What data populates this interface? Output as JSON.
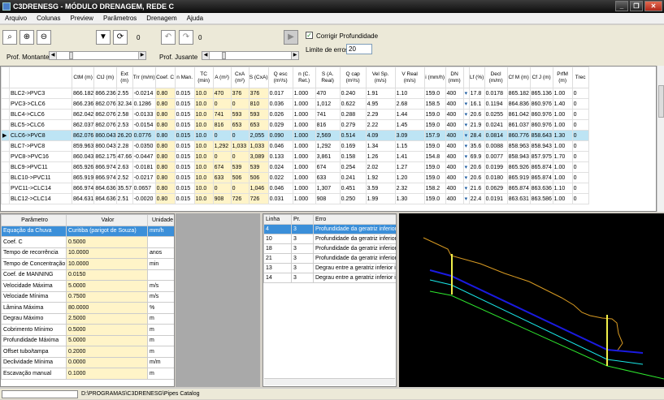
{
  "title": "C3DRENESG - MÓDULO DRENAGEM, REDE C",
  "menu": [
    "Arquivo",
    "Colunas",
    "Preview",
    "Parâmetros",
    "Drenagem",
    "Ajuda"
  ],
  "toolbar": {
    "count1": "0",
    "count2": "0",
    "checkbox_label": "Corrigir Profundidade",
    "checkbox_checked": true,
    "prof_montante_label": "Prof. Montante",
    "prof_jusante_label": "Prof. Jusante",
    "limite_label": "Limite de erros",
    "limite_value": "20"
  },
  "grid": {
    "headers": [
      "",
      "",
      "CtM (m)",
      "CtJ (m)",
      "Ext (m)",
      "Trr (m/m)",
      "Coef. C",
      "n Man.",
      "TC (min)",
      "A (m²)",
      "CxA (m²)",
      "S (CxA)",
      "Q esc (m³/s)",
      "n (C. Ret.)",
      "S (A. Real)",
      "Q cap (m³/s)",
      "Vel Sp. (m/s)",
      "V Real (m/s)",
      "i (mm/h)",
      "DN (mm)",
      "",
      "Lf (%)",
      "Decl (m/m)",
      "Cf M (m)",
      "Cf J (m)",
      "PrfM (m)",
      "Trec"
    ],
    "rows": [
      {
        "mark": "",
        "name": "BLC2->PVC3",
        "c": [
          "866.182",
          "866.236",
          "2.55",
          "-0.0214",
          "0.80",
          "0.015",
          "10.0",
          "470",
          "376",
          "376",
          "0.017",
          "1.000",
          "470",
          "0.240",
          "1.91",
          "1.10",
          "159.0",
          "400",
          "",
          "17.8",
          "0.0178",
          "865.182",
          "865.136",
          "1.00",
          "0"
        ]
      },
      {
        "mark": "",
        "name": "PVC3->CLC6",
        "c": [
          "866.236",
          "862.076",
          "32.34",
          "0.1286",
          "0.80",
          "0.015",
          "10.0",
          "0",
          "0",
          "810",
          "0.036",
          "1.000",
          "1,012",
          "0.622",
          "4.95",
          "2.68",
          "158.5",
          "400",
          "",
          "16.1",
          "0.1194",
          "864.836",
          "860.976",
          "1.40",
          "0"
        ]
      },
      {
        "mark": "",
        "name": "BLC4->CLC6",
        "c": [
          "862.042",
          "862.076",
          "2.58",
          "-0.0133",
          "0.80",
          "0.015",
          "10.0",
          "741",
          "593",
          "593",
          "0.026",
          "1.000",
          "741",
          "0.288",
          "2.29",
          "1.44",
          "159.0",
          "400",
          "",
          "20.6",
          "0.0255",
          "861.042",
          "860.976",
          "1.00",
          "0"
        ]
      },
      {
        "mark": "",
        "name": "BLC5->CLC6",
        "c": [
          "862.037",
          "862.076",
          "2.53",
          "-0.0154",
          "0.80",
          "0.015",
          "10.0",
          "816",
          "653",
          "653",
          "0.029",
          "1.000",
          "816",
          "0.279",
          "2.22",
          "1.45",
          "159.0",
          "400",
          "",
          "21.9",
          "0.0241",
          "861.037",
          "860.976",
          "1.00",
          "0"
        ]
      },
      {
        "mark": "▶",
        "name": "CLC6->PVC8",
        "c": [
          "862.076",
          "860.043",
          "26.20",
          "0.0776",
          "0.80",
          "0.015",
          "10.0",
          "0",
          "0",
          "2,055",
          "0.090",
          "1.000",
          "2,569",
          "0.514",
          "4.09",
          "3.09",
          "157.9",
          "400",
          "",
          "28.4",
          "0.0814",
          "860.776",
          "858.643",
          "1.30",
          "0"
        ]
      },
      {
        "mark": "",
        "name": "BLC7->PVC8",
        "c": [
          "859.963",
          "860.043",
          "2.28",
          "-0.0350",
          "0.80",
          "0.015",
          "10.0",
          "1,292",
          "1,033",
          "1,033",
          "0.046",
          "1.000",
          "1,292",
          "0.169",
          "1.34",
          "1.15",
          "159.0",
          "400",
          "",
          "35.6",
          "0.0088",
          "858.963",
          "858.943",
          "1.00",
          "0"
        ]
      },
      {
        "mark": "",
        "name": "PVC8->PVC16",
        "c": [
          "860.043",
          "862.175",
          "47.66",
          "-0.0447",
          "0.80",
          "0.015",
          "10.0",
          "0",
          "0",
          "3,089",
          "0.133",
          "1.000",
          "3,861",
          "0.158",
          "1.26",
          "1.41",
          "154.8",
          "400",
          "",
          "69.9",
          "0.0077",
          "858.943",
          "857.975",
          "1.70",
          "0"
        ]
      },
      {
        "mark": "",
        "name": "BLC9->PVC11",
        "c": [
          "865.926",
          "866.974",
          "2.63",
          "-0.0181",
          "0.80",
          "0.015",
          "10.0",
          "674",
          "539",
          "539",
          "0.024",
          "1.000",
          "674",
          "0.254",
          "2.02",
          "1.27",
          "159.0",
          "400",
          "",
          "20.6",
          "0.0199",
          "865.926",
          "865.874",
          "1.00",
          "0"
        ]
      },
      {
        "mark": "",
        "name": "BLC10->PVC11",
        "c": [
          "865.919",
          "866.974",
          "2.52",
          "-0.0217",
          "0.80",
          "0.015",
          "10.0",
          "633",
          "506",
          "506",
          "0.022",
          "1.000",
          "633",
          "0.241",
          "1.92",
          "1.20",
          "159.0",
          "400",
          "",
          "20.6",
          "0.0180",
          "865.919",
          "865.874",
          "1.00",
          "0"
        ]
      },
      {
        "mark": "",
        "name": "PVC11->CLC14",
        "c": [
          "866.974",
          "864.636",
          "35.57",
          "0.0657",
          "0.80",
          "0.015",
          "10.0",
          "0",
          "0",
          "1,046",
          "0.046",
          "1.000",
          "1,307",
          "0.451",
          "3.59",
          "2.32",
          "158.2",
          "400",
          "",
          "21.6",
          "0.0629",
          "865.874",
          "863.636",
          "1.10",
          "0"
        ]
      },
      {
        "mark": "",
        "name": "BLC12->CLC14",
        "c": [
          "864.631",
          "864.636",
          "2.51",
          "-0.0020",
          "0.80",
          "0.015",
          "10.0",
          "908",
          "726",
          "726",
          "0.031",
          "1.000",
          "908",
          "0.250",
          "1.99",
          "1.30",
          "159.0",
          "400",
          "",
          "22.4",
          "0.0191",
          "863.631",
          "863.586",
          "1.00",
          "0"
        ]
      }
    ]
  },
  "props": {
    "headers": [
      "Parâmetro",
      "Valor",
      "Unidade"
    ],
    "rows": [
      {
        "p": "Equação da Chuva",
        "v": "Curitiba (parigot de Souza)",
        "u": "mm/h",
        "sel": true
      },
      {
        "p": "Coef. C",
        "v": "0.5000",
        "u": ""
      },
      {
        "p": "Tempo de recorrência",
        "v": "10.0000",
        "u": "anos"
      },
      {
        "p": "Tempo de Concentração",
        "v": "10.0000",
        "u": "min"
      },
      {
        "p": "Coef. de MANNING",
        "v": "0.0150",
        "u": ""
      },
      {
        "p": "Velocidade Máxima",
        "v": "5.0000",
        "u": "m/s"
      },
      {
        "p": "Velociade Mínima",
        "v": "0.7500",
        "u": "m/s"
      },
      {
        "p": "Lâmina Máxima",
        "v": "80.0000",
        "u": "%"
      },
      {
        "p": "Degrau Máximo",
        "v": "2.5000",
        "u": "m"
      },
      {
        "p": "Cobrimento Mínimo",
        "v": "0.5000",
        "u": "m"
      },
      {
        "p": "Profundidade Máxima",
        "v": "5.0000",
        "u": "m"
      },
      {
        "p": "Offset tubo/tampa",
        "v": "0.2000",
        "u": "m"
      },
      {
        "p": "Declividade Mínima",
        "v": "0.0000",
        "u": "m/m"
      },
      {
        "p": "Escavação manual",
        "v": "0.1000",
        "u": "m"
      }
    ]
  },
  "errors": {
    "headers": [
      "Linha",
      "Pr.",
      "Erro"
    ],
    "rows": [
      {
        "l": "4",
        "p": "3",
        "e": "Profundidade da geratriz inferior",
        "sel": true
      },
      {
        "l": "10",
        "p": "3",
        "e": "Profundidade da geratriz inferior"
      },
      {
        "l": "18",
        "p": "3",
        "e": "Profundidade da geratriz inferior"
      },
      {
        "l": "21",
        "p": "3",
        "e": "Profundidade da geratriz inferior"
      },
      {
        "l": "13",
        "p": "3",
        "e": "Degrau entre a geratriz inferior in"
      },
      {
        "l": "14",
        "p": "3",
        "e": "Degrau entre a geratriz inferior in"
      }
    ]
  },
  "status": {
    "path": "D:\\PROGRAMAS\\C3DRENESG\\Pipes Catalog"
  },
  "icons": {
    "zoom_fit": "zoom-fit-icon",
    "zoom_in": "zoom-in-icon",
    "zoom_out": "zoom-out-icon",
    "filter": "filter-icon",
    "refresh": "refresh-icon",
    "undo": "undo-icon",
    "redo": "redo-icon",
    "play": "play-icon"
  }
}
